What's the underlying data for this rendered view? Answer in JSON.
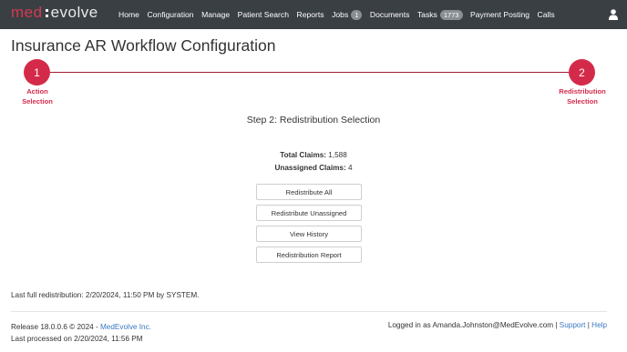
{
  "brand": {
    "logo_left": "med",
    "logo_right": "evolve"
  },
  "nav": {
    "items": [
      {
        "label": "Home"
      },
      {
        "label": "Configuration"
      },
      {
        "label": "Manage"
      },
      {
        "label": "Patient Search"
      },
      {
        "label": "Reports"
      },
      {
        "label": "Jobs",
        "badge": "1"
      },
      {
        "label": "Documents"
      },
      {
        "label": "Tasks",
        "badge": "1773"
      },
      {
        "label": "Payment Posting"
      },
      {
        "label": "Calls"
      }
    ]
  },
  "page": {
    "title": "Insurance AR Workflow Configuration"
  },
  "stepper": {
    "steps": [
      {
        "number": "1",
        "label_line1": "Action",
        "label_line2": "Selection"
      },
      {
        "number": "2",
        "label_line1": "Redistribution",
        "label_line2": "Selection"
      }
    ],
    "current_heading": "Step 2: Redistribution Selection"
  },
  "claims": {
    "total_label": "Total Claims:",
    "total_value": "1,588",
    "unassigned_label": "Unassigned Claims:",
    "unassigned_value": "4"
  },
  "actions": {
    "redistribute_all": "Redistribute All",
    "redistribute_unassigned": "Redistribute Unassigned",
    "view_history": "View History",
    "redistribution_report": "Redistribution Report"
  },
  "status": {
    "last_full_redistribution": "Last full redistribution: 2/20/2024, 11:50 PM by SYSTEM."
  },
  "footer": {
    "release_text": "Release 18.0.0.6 © 2024 - ",
    "company_link": "MedEvolve Inc.",
    "last_processed": "Last processed on 2/20/2024, 11:56 PM",
    "logged_in_text": "Logged in as Amanda.Johnston@MedEvolve.com | ",
    "support_link": "Support",
    "separator": " | ",
    "help_link": "Help"
  },
  "colors": {
    "nav_bg": "#3a3f44",
    "brand_red": "#d42a4a",
    "link_blue": "#3b78c3"
  }
}
